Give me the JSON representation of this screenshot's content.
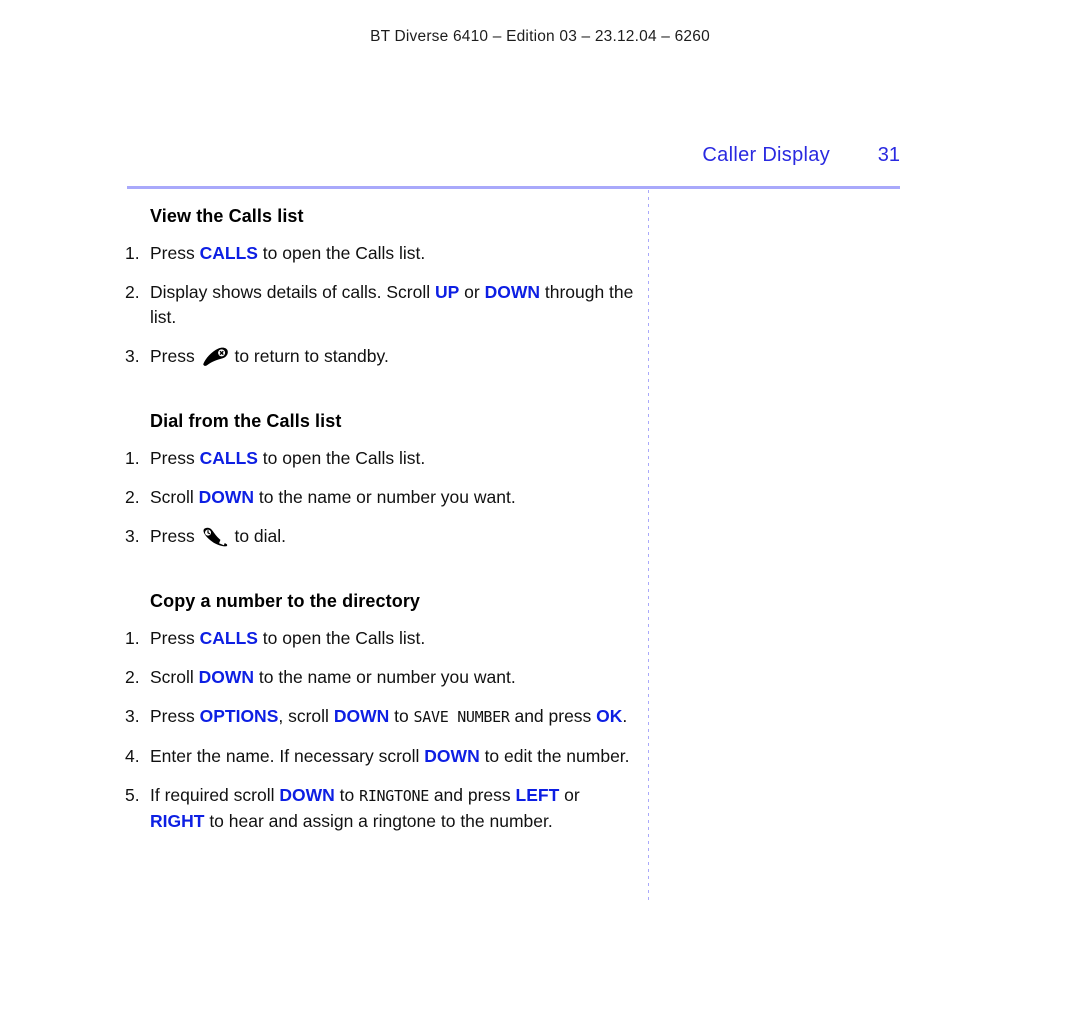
{
  "header": {
    "running_head": "BT Diverse 6410 – Edition 03 – 23.12.04 – 6260"
  },
  "chapter": {
    "title": "Caller Display",
    "page_number": "31",
    "accent_color": "#2a2ae0",
    "rule_color": "#a9a9fb"
  },
  "sections": [
    {
      "heading": "View the Calls list",
      "steps": [
        {
          "num": "1.",
          "parts": [
            {
              "type": "text",
              "value": "Press "
            },
            {
              "type": "key",
              "value": "CALLS"
            },
            {
              "type": "text",
              "value": " to open the Calls list."
            }
          ]
        },
        {
          "num": "2.",
          "parts": [
            {
              "type": "text",
              "value": "Display shows details of calls. Scroll "
            },
            {
              "type": "key",
              "value": "UP"
            },
            {
              "type": "text",
              "value": " or "
            },
            {
              "type": "key",
              "value": "DOWN"
            },
            {
              "type": "text",
              "value": " through the list."
            }
          ]
        },
        {
          "num": "3.",
          "parts": [
            {
              "type": "text",
              "value": "Press "
            },
            {
              "type": "icon",
              "value": "handset-hangup-icon"
            },
            {
              "type": "text",
              "value": " to return to standby."
            }
          ]
        }
      ]
    },
    {
      "heading": "Dial from the Calls list",
      "steps": [
        {
          "num": "1.",
          "parts": [
            {
              "type": "text",
              "value": "Press "
            },
            {
              "type": "key",
              "value": "CALLS"
            },
            {
              "type": "text",
              "value": " to open the Calls list."
            }
          ]
        },
        {
          "num": "2.",
          "parts": [
            {
              "type": "text",
              "value": "Scroll "
            },
            {
              "type": "key",
              "value": "DOWN"
            },
            {
              "type": "text",
              "value": " to the name or number you want."
            }
          ]
        },
        {
          "num": "3.",
          "parts": [
            {
              "type": "text",
              "value": "Press "
            },
            {
              "type": "icon",
              "value": "handset-dial-icon"
            },
            {
              "type": "text",
              "value": " to dial."
            }
          ]
        }
      ]
    },
    {
      "heading": "Copy a number to the directory",
      "steps": [
        {
          "num": "1.",
          "parts": [
            {
              "type": "text",
              "value": "Press "
            },
            {
              "type": "key",
              "value": "CALLS"
            },
            {
              "type": "text",
              "value": " to open the Calls list."
            }
          ]
        },
        {
          "num": "2.",
          "parts": [
            {
              "type": "text",
              "value": "Scroll "
            },
            {
              "type": "key",
              "value": "DOWN"
            },
            {
              "type": "text",
              "value": " to the name or number you want."
            }
          ]
        },
        {
          "num": "3.",
          "parts": [
            {
              "type": "text",
              "value": "Press "
            },
            {
              "type": "key",
              "value": "OPTIONS"
            },
            {
              "type": "text",
              "value": ", scroll "
            },
            {
              "type": "key",
              "value": "DOWN"
            },
            {
              "type": "text",
              "value": " to "
            },
            {
              "type": "lcd",
              "value": "SAVE NUMBER"
            },
            {
              "type": "text",
              "value": " and press "
            },
            {
              "type": "key",
              "value": "OK"
            },
            {
              "type": "text",
              "value": "."
            }
          ]
        },
        {
          "num": "4.",
          "parts": [
            {
              "type": "text",
              "value": "Enter the name. If necessary scroll "
            },
            {
              "type": "key",
              "value": "DOWN"
            },
            {
              "type": "text",
              "value": " to edit the number."
            }
          ]
        },
        {
          "num": "5.",
          "parts": [
            {
              "type": "text",
              "value": "If required scroll "
            },
            {
              "type": "key",
              "value": "DOWN"
            },
            {
              "type": "text",
              "value": " to "
            },
            {
              "type": "lcd",
              "value": "RINGTONE"
            },
            {
              "type": "text",
              "value": " and press "
            },
            {
              "type": "key",
              "value": "LEFT"
            },
            {
              "type": "text",
              "value": " or "
            },
            {
              "type": "key",
              "value": "RIGHT"
            },
            {
              "type": "text",
              "value": " to hear and assign a ringtone to the number."
            }
          ]
        }
      ]
    }
  ]
}
